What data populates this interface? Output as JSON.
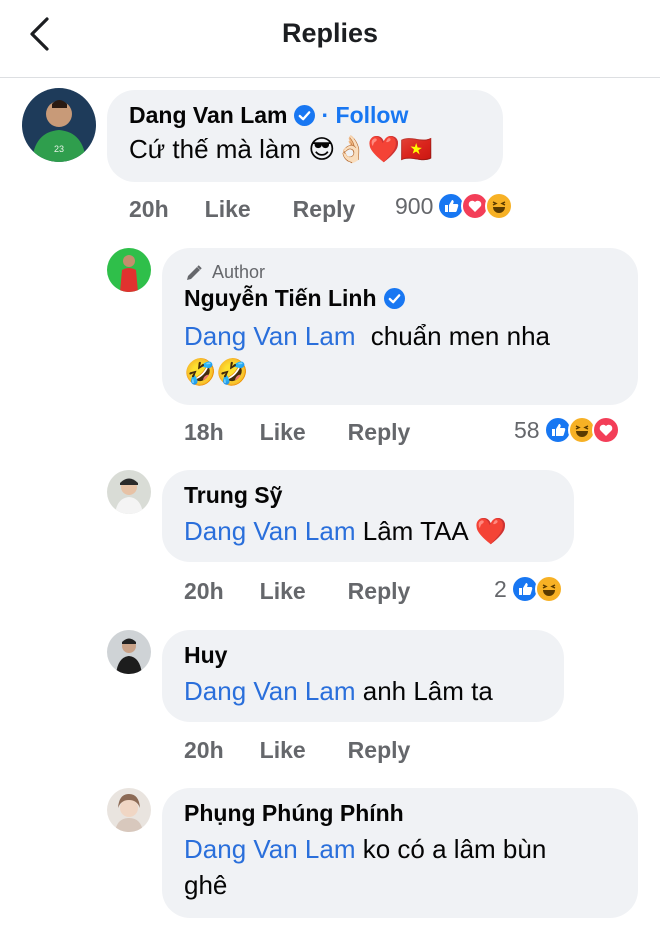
{
  "header": {
    "title": "Replies"
  },
  "comments": [
    {
      "name": "Dang Van Lam",
      "follow": "· Follow",
      "text": "Cứ thế mà làm 😎👌🏻❤️🇻🇳",
      "time": "20h",
      "like": "Like",
      "reply": "Reply",
      "reaction_count": "900",
      "reactions": [
        "like-icon",
        "love-icon",
        "haha-icon"
      ]
    },
    {
      "author_label": "Author",
      "name": "Nguyễn Tiến Linh",
      "mention": "Dang Van Lam",
      "text": " chuẩn men nha",
      "text2": "🤣🤣",
      "time": "18h",
      "like": "Like",
      "reply": "Reply",
      "reaction_count": "58",
      "reactions": [
        "like-icon",
        "haha-icon",
        "love-icon"
      ]
    },
    {
      "name": "Trung Sỹ",
      "mention": "Dang Van Lam",
      "text": " Lâm TAA ❤️",
      "time": "20h",
      "like": "Like",
      "reply": "Reply",
      "reaction_count": "2",
      "reactions": [
        "like-icon",
        "haha-icon"
      ]
    },
    {
      "name": "Huy",
      "mention": "Dang Van Lam",
      "text": " anh Lâm ta",
      "time": "20h",
      "like": "Like",
      "reply": "Reply"
    },
    {
      "name": "Phụng Phúng Phính",
      "mention": "Dang Van Lam",
      "text": " ko có a lâm bùn",
      "text2": "ghê"
    }
  ],
  "colors": {
    "accent": "#1877f2",
    "bubble": "#f0f2f5",
    "meta": "#65676b",
    "love": "#f33e58",
    "haha": "#f7b125"
  }
}
